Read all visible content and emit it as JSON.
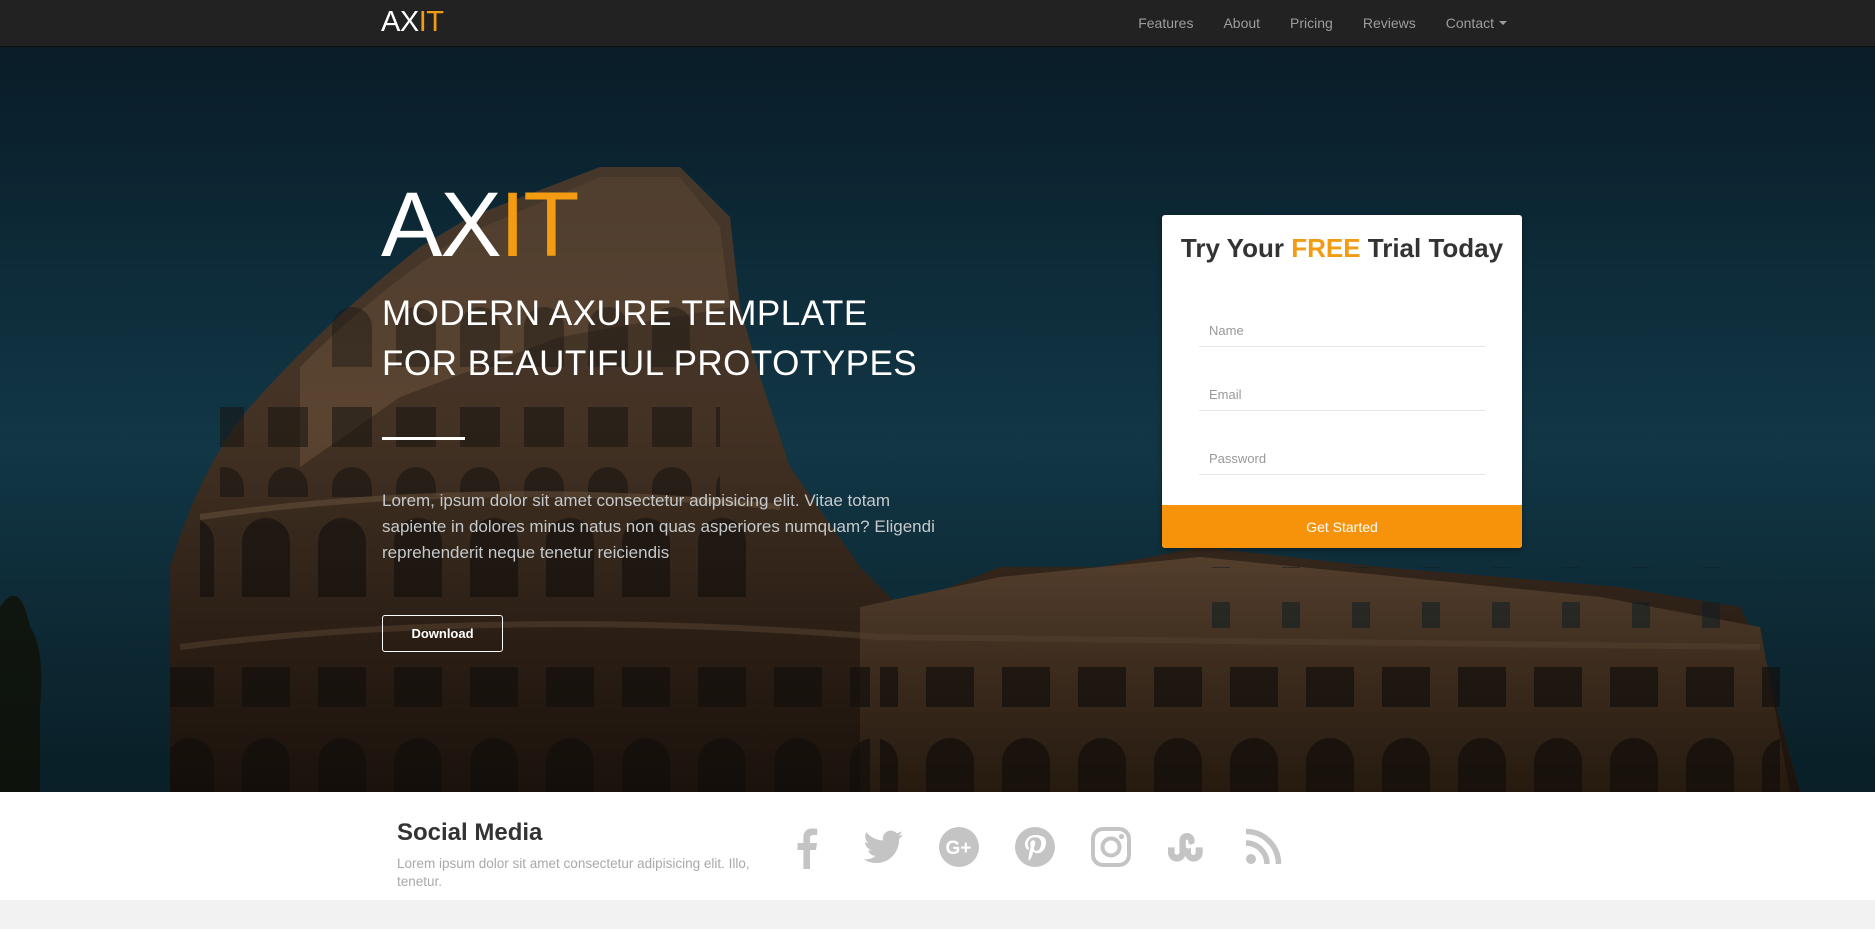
{
  "brand": {
    "prefix": "AX",
    "accent": "IT"
  },
  "nav": [
    {
      "label": "Features"
    },
    {
      "label": "About"
    },
    {
      "label": "Pricing"
    },
    {
      "label": "Reviews"
    },
    {
      "label": "Contact",
      "dropdown": true
    }
  ],
  "hero": {
    "logo_prefix": "AX",
    "logo_accent": "IT",
    "title_line1": "MODERN AXURE TEMPLATE",
    "title_line2": "FOR BEAUTIFUL PROTOTYPES",
    "text": "Lorem, ipsum dolor sit amet consectetur adipisicing elit. Vitae totam sapiente in dolores minus natus non quas asperiores numquam? Eligendi reprehenderit neque tenetur reiciendis",
    "download_label": "Download"
  },
  "trial": {
    "title_before": "Try Your ",
    "title_accent": "FREE",
    "title_after": " Trial Today",
    "name_placeholder": "Name",
    "email_placeholder": "Email",
    "password_placeholder": "Password",
    "submit_label": "Get Started"
  },
  "social": {
    "title": "Social Media",
    "description": "Lorem ipsum dolor sit amet consectetur adipisicing elit. Illo, tenetur.",
    "icons": [
      "facebook-icon",
      "twitter-icon",
      "google-plus-icon",
      "pinterest-icon",
      "instagram-icon",
      "stumbleupon-icon",
      "rss-icon"
    ]
  },
  "colors": {
    "accent": "#f39c12",
    "button": "#f7930a",
    "navbar": "#222222",
    "icon_gray": "#c4c4c4"
  }
}
